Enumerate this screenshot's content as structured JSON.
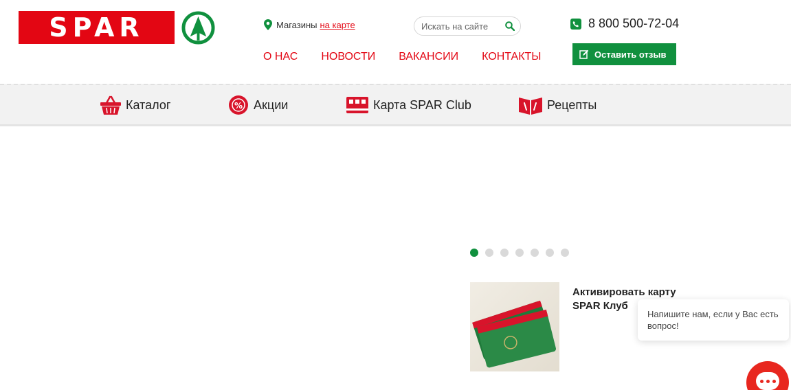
{
  "header": {
    "logo_text": "SPAR",
    "stores_label": "Магазины",
    "stores_link": "на карте",
    "search_placeholder": "Искать на сайте",
    "phone": "8 800 500-72-04",
    "feedback_button": "Оставить отзыв",
    "nav": [
      "О НАС",
      "НОВОСТИ",
      "ВАКАНСИИ",
      "КОНТАКТЫ"
    ]
  },
  "categories": [
    {
      "label": "Каталог",
      "icon": "basket-icon"
    },
    {
      "label": "Акции",
      "icon": "percent-badge-icon"
    },
    {
      "label": "Карта SPAR Club",
      "icon": "card-icon"
    },
    {
      "label": "Рецепты",
      "icon": "recipe-book-icon"
    }
  ],
  "slider": {
    "dots_total": 7,
    "active_index": 0
  },
  "promo": {
    "title": "Активировать карту SPAR Клуб"
  },
  "chat": {
    "message": "Напишите нам, если у Вас есть вопрос!"
  },
  "colors": {
    "brand_red": "#e30613",
    "brand_green": "#10903e",
    "chat_red": "#e8271f"
  }
}
